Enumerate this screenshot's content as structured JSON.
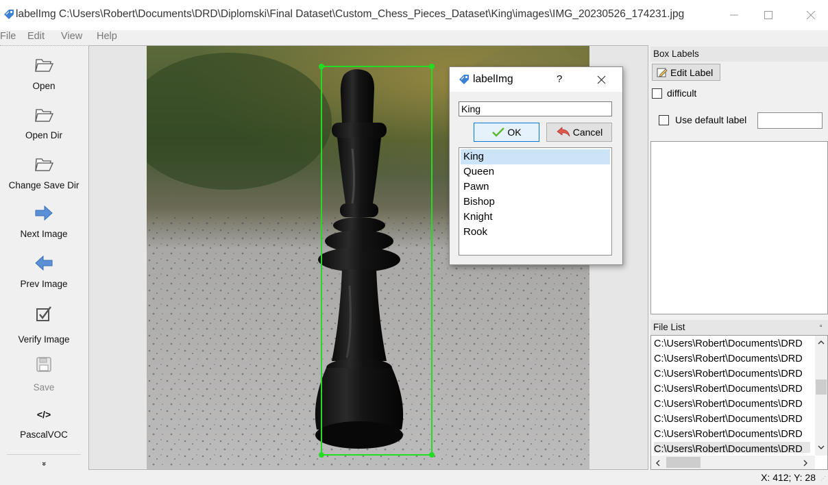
{
  "window": {
    "app_icon": "labelimg-tag-icon",
    "title": "labelImg C:\\Users\\Robert\\Documents\\DRD\\Diplomski\\Final Dataset\\Custom_Chess_Pieces_Dataset\\King\\images\\IMG_20230526_174231.jpg",
    "controls": [
      "minimize-icon",
      "maximize-icon",
      "close-icon"
    ]
  },
  "menu": [
    "File",
    "Edit",
    "View",
    "Help"
  ],
  "toolbar": {
    "open": "Open",
    "open_dir": "Open Dir",
    "change_save_dir": "Change Save Dir",
    "next_image": "Next Image",
    "prev_image": "Prev Image",
    "verify_image": "Verify Image",
    "save": "Save",
    "format_glyph": "</>",
    "format": "PascalVOC",
    "more_glyph": "»"
  },
  "box_labels": {
    "title": "Box Labels",
    "edit_label": "Edit Label",
    "difficult": "difficult",
    "use_default_label": "Use default label",
    "default_label_value": ""
  },
  "file_list": {
    "title": "File List",
    "items": [
      "C:\\Users\\Robert\\Documents\\DRD",
      "C:\\Users\\Robert\\Documents\\DRD",
      "C:\\Users\\Robert\\Documents\\DRD",
      "C:\\Users\\Robert\\Documents\\DRD",
      "C:\\Users\\Robert\\Documents\\DRD",
      "C:\\Users\\Robert\\Documents\\DRD",
      "C:\\Users\\Robert\\Documents\\DRD",
      "C:\\Users\\Robert\\Documents\\DRD"
    ]
  },
  "status": "X: 412; Y: 28",
  "dialog": {
    "title": "labelImg",
    "help": "?",
    "input_value": "King",
    "ok": "OK",
    "cancel": "Cancel",
    "labels": [
      "King",
      "Queen",
      "Pawn",
      "Bishop",
      "Knight",
      "Rook"
    ],
    "selected": "King"
  },
  "colors": {
    "bbox": "#22dd22",
    "selection": "#cce4f7",
    "accent_blue": "#4a90d9"
  }
}
